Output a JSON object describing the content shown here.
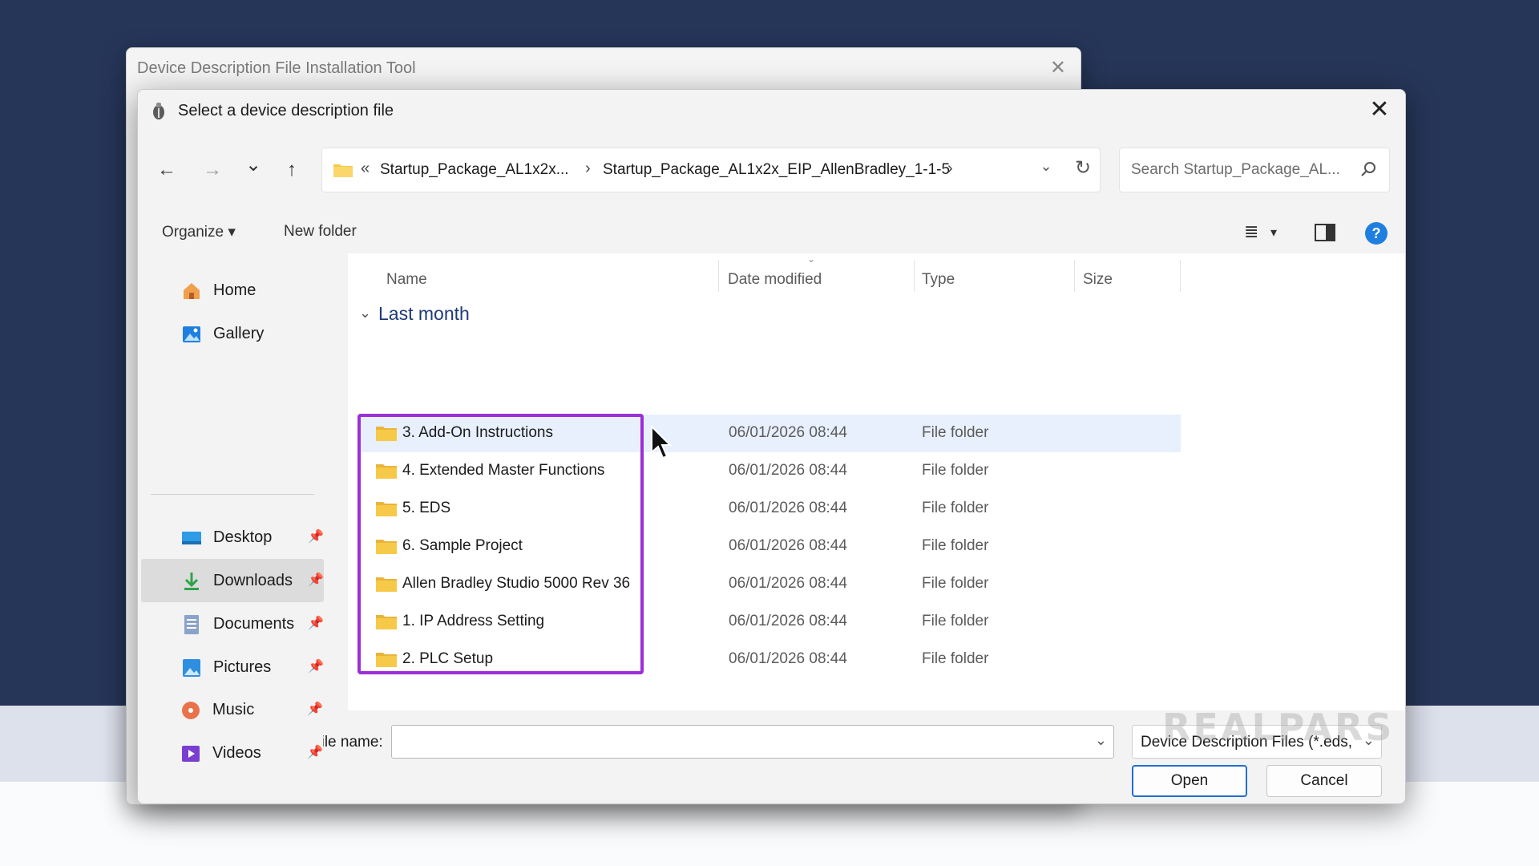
{
  "back_window": {
    "title": "Device Description File Installation Tool",
    "close_glyph": "✕"
  },
  "dialog": {
    "title": "Select a device description file",
    "close_glyph": "✕"
  },
  "nav": {
    "back": "←",
    "forward": "→",
    "recent": "⌄",
    "up": "↑",
    "address_prefix": "«",
    "address_segments": [
      "Startup_Package_AL1x2x...",
      "Startup_Package_AL1x2x_EIP_AllenBradley_1-1-5"
    ],
    "separator": "›",
    "dropdown": "⌄",
    "refresh": "↻",
    "search_placeholder": "Search Startup_Package_AL..."
  },
  "toolbar": {
    "organize": "Organize ▾",
    "new_folder": "New folder",
    "view_icon": "≣",
    "view_dropdown": "▾",
    "help": "?"
  },
  "sidebar": {
    "items": [
      {
        "label": "Home",
        "icon": "home-icon",
        "pinned": false
      },
      {
        "label": "Gallery",
        "icon": "gallery-icon",
        "pinned": false
      },
      {
        "label": "Desktop",
        "icon": "desktop-icon",
        "pinned": true
      },
      {
        "label": "Downloads",
        "icon": "downloads-icon",
        "pinned": true,
        "selected": true
      },
      {
        "label": "Documents",
        "icon": "documents-icon",
        "pinned": true
      },
      {
        "label": "Pictures",
        "icon": "pictures-icon",
        "pinned": true
      },
      {
        "label": "Music",
        "icon": "music-icon",
        "pinned": true
      },
      {
        "label": "Videos",
        "icon": "videos-icon",
        "pinned": true
      }
    ],
    "pin_glyph": "📌"
  },
  "columns": [
    "Name",
    "Date modified",
    "Type",
    "Size"
  ],
  "group": {
    "label": "Last month",
    "chevron": "⌄"
  },
  "files": [
    {
      "name": "3. Add-On Instructions",
      "date": "06/01/2026 08:44",
      "type": "File folder"
    },
    {
      "name": "4. Extended Master Functions",
      "date": "06/01/2026 08:44",
      "type": "File folder"
    },
    {
      "name": "5. EDS",
      "date": "06/01/2026 08:44",
      "type": "File folder"
    },
    {
      "name": "6. Sample Project",
      "date": "06/01/2026 08:44",
      "type": "File folder"
    },
    {
      "name": "Allen Bradley Studio 5000 Rev 36",
      "date": "06/01/2026 08:44",
      "type": "File folder"
    },
    {
      "name": "1. IP Address Setting",
      "date": "06/01/2026 08:44",
      "type": "File folder"
    },
    {
      "name": "2. PLC Setup",
      "date": "06/01/2026 08:44",
      "type": "File folder"
    }
  ],
  "footer": {
    "file_name_label": "File name:",
    "file_name_value": "",
    "filter": "Device Description Files (*.eds,",
    "dropdown": "⌄",
    "open": "Open",
    "cancel": "Cancel"
  },
  "watermark": "REALPARS",
  "colors": {
    "accent": "#1f6fd0",
    "highlight_box": "#9b2fd6",
    "folder": "#f7c948",
    "background": "#263659"
  }
}
